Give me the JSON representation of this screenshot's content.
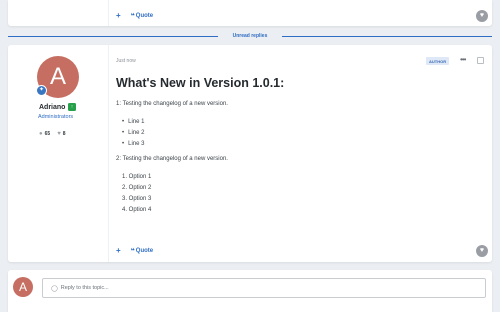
{
  "top_post": {
    "add_label": "+",
    "quote_label": "Quote"
  },
  "divider": {
    "label": "Unread replies"
  },
  "post": {
    "author": {
      "initial": "A",
      "name": "Adriano",
      "group": "Administrators",
      "posts_count": "65",
      "likes_count": "8"
    },
    "time": "Just now",
    "author_badge": "AUTHOR",
    "more_label": "•••",
    "title": "What's New in Version 1.0.1:",
    "para1": "1: Testing the changelog of a new version.",
    "bullets": [
      "Line 1",
      "Line 2",
      "Line 3"
    ],
    "para2": "2: Testing the changelog of a new version.",
    "numbered": [
      "1. Option 1",
      "2. Option 2",
      "3. Option 3",
      "4. Option 4"
    ],
    "add_label": "+",
    "quote_label": "Quote"
  },
  "reply": {
    "initial": "A",
    "placeholder": "Reply to this topic..."
  },
  "colors": {
    "accent": "#2f6dc4",
    "avatar": "#c56e61",
    "rank": "#27a04a"
  }
}
